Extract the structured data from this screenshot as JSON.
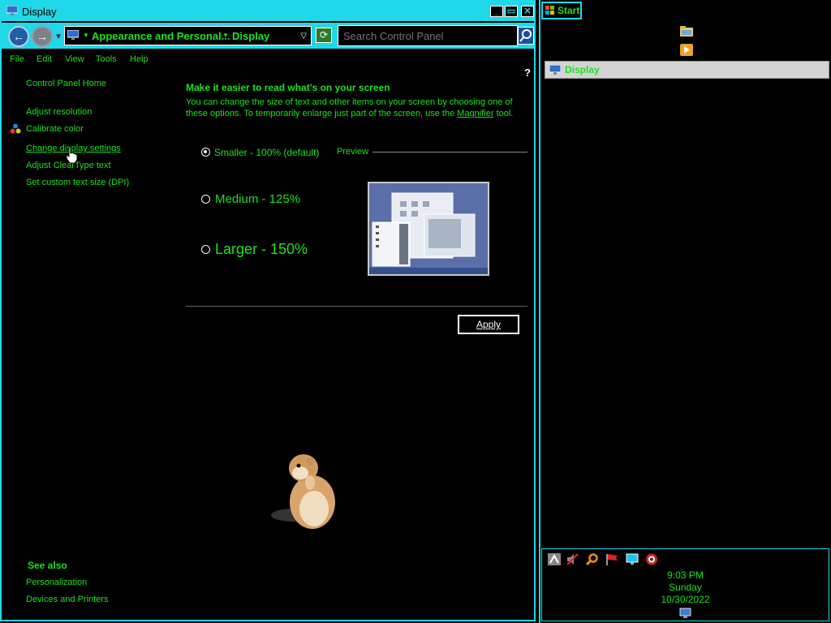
{
  "window": {
    "title": "Display",
    "address": {
      "crumb1": "Appearance and Personal...",
      "crumb2": "Display"
    },
    "search_placeholder": "Search Control Panel",
    "menu": [
      "File",
      "Edit",
      "View",
      "Tools",
      "Help"
    ],
    "help_glyph": "?"
  },
  "sidebar": {
    "home": "Control Panel Home",
    "links": [
      "Adjust resolution",
      "Calibrate color",
      "Change display settings",
      "Adjust ClearType text",
      "Set custom text size (DPI)"
    ],
    "see_also_heading": "See also",
    "see_also": [
      "Personalization",
      "Devices and Printers"
    ]
  },
  "main": {
    "heading": "Make it easier to read what's on your screen",
    "desc_before": "You can change the size of text and other items on your screen by choosing one of these options. To temporarily enlarge just part of the screen, use the ",
    "desc_link": "Magnifier",
    "desc_after": " tool.",
    "options": [
      {
        "label": "Smaller - 100% (default)",
        "selected": true
      },
      {
        "label": "Medium - 125%",
        "selected": false
      },
      {
        "label": "Larger - 150%",
        "selected": false
      }
    ],
    "preview_label": "Preview",
    "apply_label": "Apply"
  },
  "taskbar": {
    "start_label": "Start",
    "task_item": "Display",
    "clock": {
      "time": "9:03 PM",
      "day": "Sunday",
      "date": "10/30/2022"
    }
  },
  "colors": {
    "accent": "#1fd8e8",
    "text": "#1de31d",
    "background": "#000000"
  }
}
